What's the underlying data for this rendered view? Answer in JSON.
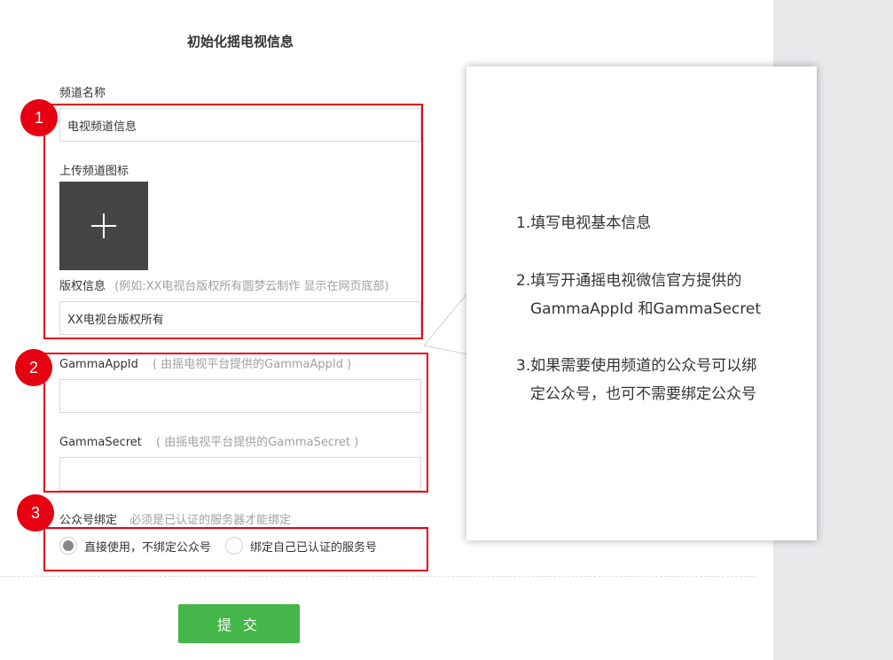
{
  "page_title": "初始化摇电视信息",
  "form": {
    "channel_name": {
      "label": "频道名称",
      "value": "电视频道信息"
    },
    "channel_icon": {
      "label": "上传频道图标",
      "icon": "plus-icon"
    },
    "copyright": {
      "label": "版权信息",
      "hint": "(例如:XX电视台版权所有圆梦云制作 显示在网页底部)",
      "value": "XX电视台版权所有"
    },
    "gamma_app_id": {
      "label": "GammaAppId",
      "hint": "( 由摇电视平台提供的GammaAppId )",
      "value": ""
    },
    "gamma_secret": {
      "label": "GammaSecret",
      "hint": "( 由摇电视平台提供的GammaSecret )",
      "value": ""
    },
    "public_account": {
      "label": "公众号绑定",
      "hint": "必须是已认证的服务器才能绑定",
      "options": [
        {
          "label": "直接使用，不绑定公众号",
          "selected": true
        },
        {
          "label": "绑定自己已认证的服务号",
          "selected": false
        }
      ]
    },
    "submit_label": "提 交"
  },
  "annotations": {
    "badges": [
      "1",
      "2",
      "3"
    ],
    "color": "#e60012"
  },
  "callout": {
    "lines": [
      "1.填写电视基本信息",
      "2.填写开通摇电视微信官方提供的",
      "GammaAppId 和GammaSecret",
      "3.如果需要使用频道的公众号可以绑",
      "定公众号，也可不需要绑定公众号"
    ]
  },
  "colors": {
    "accent_green": "#45b649",
    "annotation_red": "#e60012",
    "upload_bg": "#454545",
    "right_strip": "#e9e9ec"
  }
}
